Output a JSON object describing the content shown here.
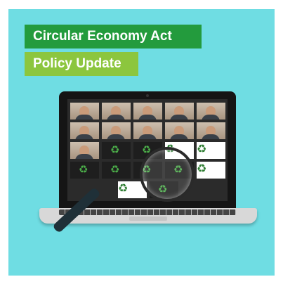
{
  "banner": {
    "title": "Circular Economy Act",
    "subtitle": "Policy Update"
  },
  "colors": {
    "background": "#6fdde3",
    "title_bg": "#239b3d",
    "subtitle_bg": "#8cc63e"
  },
  "icons": {
    "recycle": "recycle-icon",
    "magnifier": "magnifying-glass-icon"
  },
  "video_call": {
    "participants_video_tiles": 10,
    "logo_tiles": 9
  }
}
